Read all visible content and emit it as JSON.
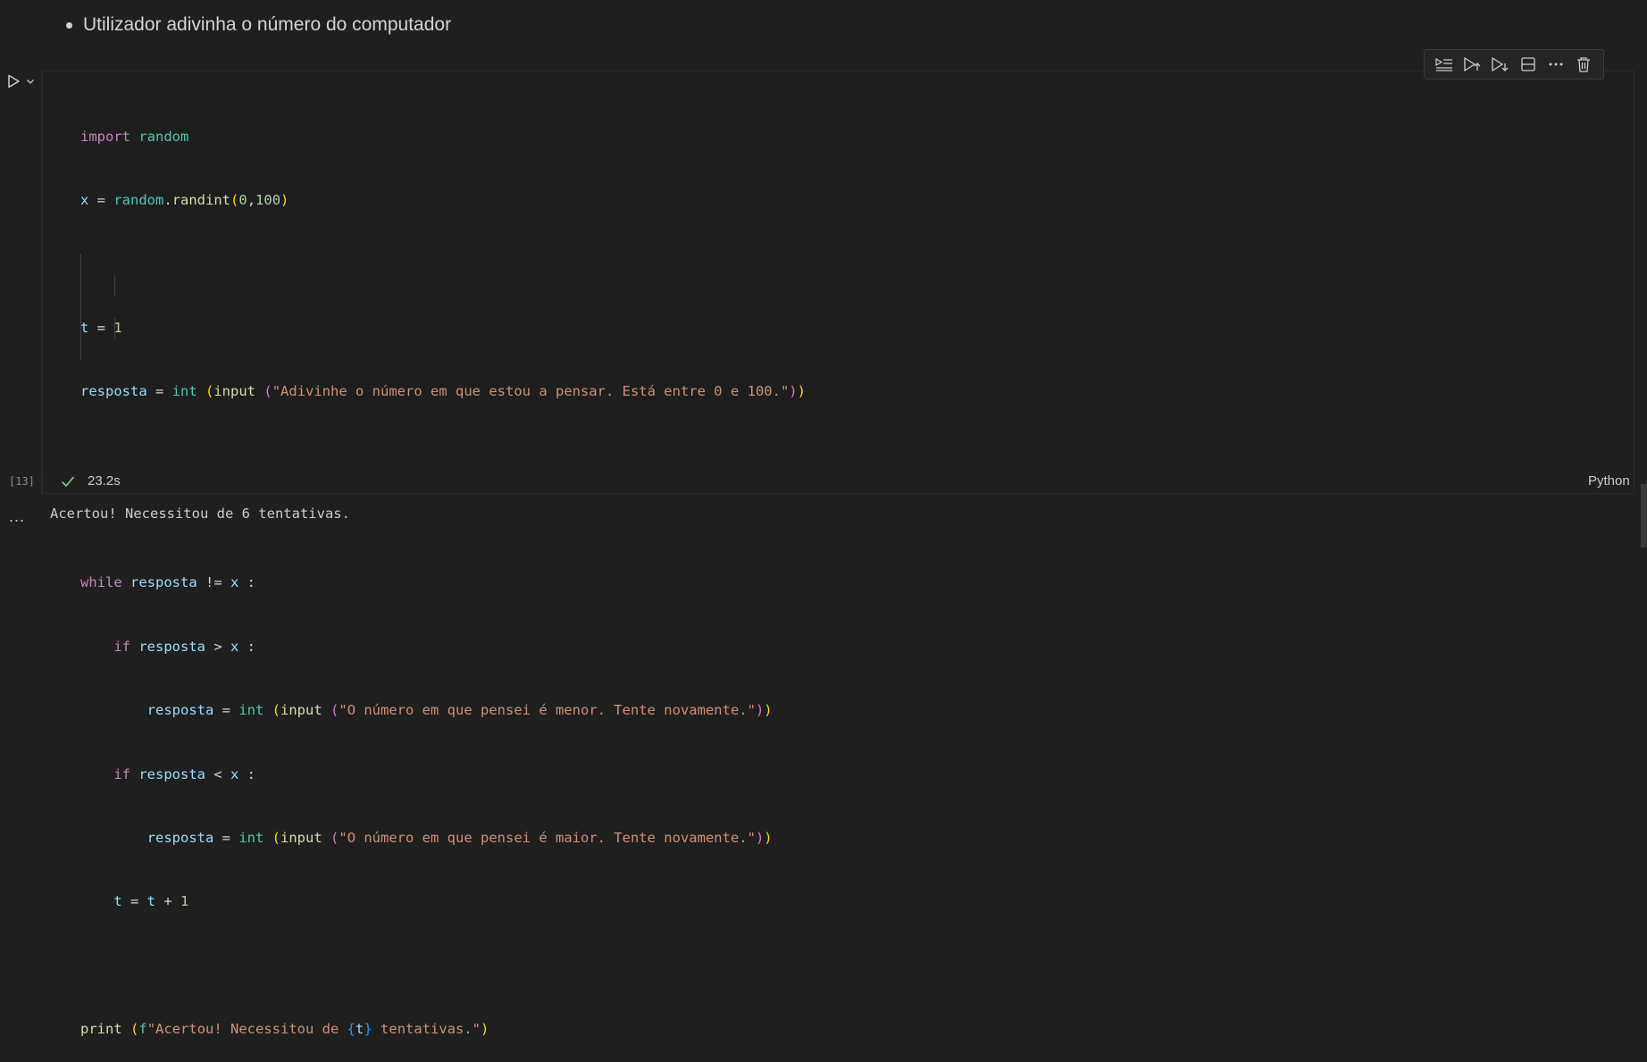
{
  "markdown": {
    "bullet": "Utilizador adivinha o número do computador"
  },
  "toolbar": {
    "buttons": [
      {
        "name": "execute-above-cells-button",
        "icon": "run-above-icon"
      },
      {
        "name": "execute-cell-and-above-button",
        "icon": "run-up-icon"
      },
      {
        "name": "execute-cell-and-below-button",
        "icon": "run-down-icon"
      },
      {
        "name": "split-cell-button",
        "icon": "split-icon"
      },
      {
        "name": "more-actions-button",
        "icon": "ellipsis-icon"
      },
      {
        "name": "delete-cell-button",
        "icon": "trash-icon"
      }
    ]
  },
  "code": {
    "l1": {
      "a": "import",
      "b": "random"
    },
    "l2": {
      "a": "x",
      "b": " = ",
      "c": "random",
      "d": ".",
      "e": "randint",
      "f": "(",
      "g": "0",
      "h": ",",
      "i": "100",
      "j": ")"
    },
    "l4": {
      "a": "t",
      "b": " = ",
      "c": "1"
    },
    "l5": {
      "a": "resposta",
      "b": " = ",
      "c": "int",
      "d": " ",
      "e": "(",
      "f": "input",
      "g": " ",
      "h": "(",
      "i": "\"Adivinhe o número em que estou a pensar. Está entre 0 e 100.\"",
      "j": ")",
      "k": ")"
    },
    "l8": {
      "a": "while",
      "b": " ",
      "c": "resposta",
      "d": " != ",
      "e": "x",
      "f": " :"
    },
    "l9": {
      "a": "if",
      "b": " ",
      "c": "resposta",
      "d": " > ",
      "e": "x",
      "f": " :"
    },
    "l10": {
      "a": "resposta",
      "b": " = ",
      "c": "int",
      "d": " ",
      "e": "(",
      "f": "input",
      "g": " ",
      "h": "(",
      "i": "\"O número em que pensei é menor. Tente novamente.\"",
      "j": ")",
      "k": ")"
    },
    "l11": {
      "a": "if",
      "b": " ",
      "c": "resposta",
      "d": " < ",
      "e": "x",
      "f": " :"
    },
    "l12": {
      "a": "resposta",
      "b": " = ",
      "c": "int",
      "d": " ",
      "e": "(",
      "f": "input",
      "g": " ",
      "h": "(",
      "i": "\"O número em que pensei é maior. Tente novamente.\"",
      "j": ")",
      "k": ")"
    },
    "l13": {
      "a": "t",
      "b": " = ",
      "c": "t",
      "d": " + ",
      "e": "1"
    },
    "l15": {
      "a": "print",
      "b": " ",
      "c": "(",
      "d": "f",
      "e": "\"Acertou! Necessitou de ",
      "f": "{",
      "g": "t",
      "h": "}",
      "i": " tentativas.\"",
      "j": ")"
    }
  },
  "status": {
    "execution_count": "[13]",
    "duration": "23.2s",
    "language": "Python",
    "success_color": "#89d185"
  },
  "output": {
    "gutter": "...",
    "text": "Acertou! Necessitou de 6 tentativas."
  }
}
